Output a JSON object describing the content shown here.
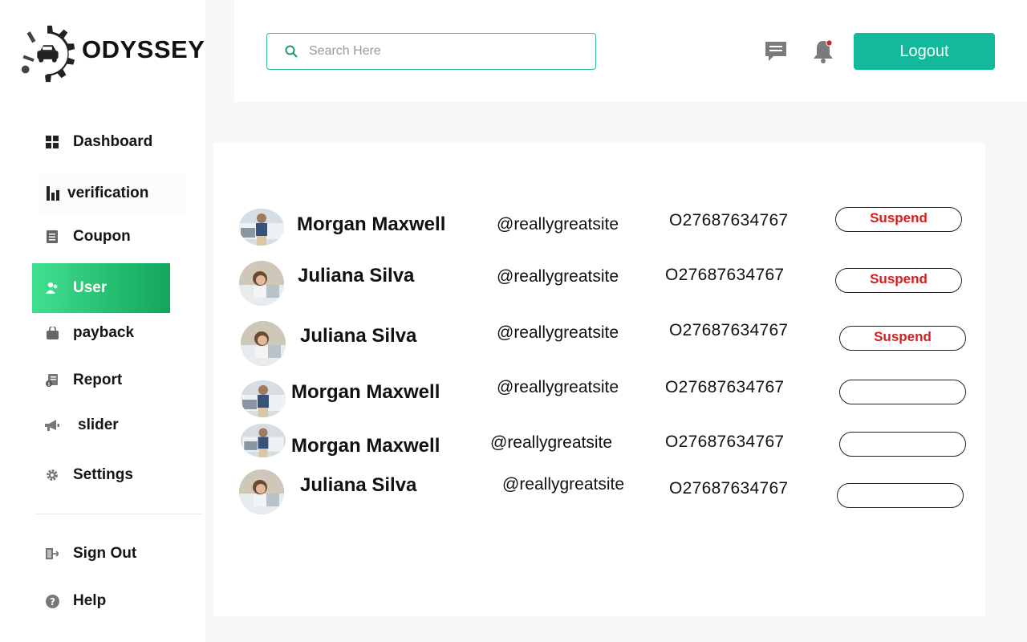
{
  "brand": {
    "name": "ODYSSEY"
  },
  "sidebar": {
    "items": [
      {
        "label": "Dashboard",
        "icon": "grid-icon"
      },
      {
        "label": "verification",
        "icon": "bar-chart-icon"
      },
      {
        "label": "Coupon",
        "icon": "document-icon"
      },
      {
        "label": "User",
        "icon": "user-icon",
        "active": true
      },
      {
        "label": "payback",
        "icon": "bag-icon"
      },
      {
        "label": "Report",
        "icon": "report-icon"
      },
      {
        "label": "slider",
        "icon": "megaphone-icon"
      },
      {
        "label": "Settings",
        "icon": "gear-icon"
      }
    ],
    "footer": [
      {
        "label": "Sign Out",
        "icon": "sign-out-icon"
      },
      {
        "label": "Help",
        "icon": "help-icon"
      }
    ]
  },
  "header": {
    "search_placeholder": "Search Here",
    "logout_label": "Logout"
  },
  "users": [
    {
      "name": "Morgan Maxwell",
      "handle": "@reallygreatsite",
      "phone": "O27687634767",
      "action": "Suspend",
      "avatar": "man-avatar"
    },
    {
      "name": "Juliana Silva",
      "handle": "@reallygreatsite",
      "phone": "O27687634767",
      "action": "Suspend",
      "avatar": "woman-avatar"
    },
    {
      "name": "Juliana Silva",
      "handle": "@reallygreatsite",
      "phone": "O27687634767",
      "action": "Suspend",
      "avatar": "woman-avatar"
    },
    {
      "name": "Morgan Maxwell",
      "handle": "@reallygreatsite",
      "phone": "O27687634767",
      "action": "",
      "avatar": "man-avatar"
    },
    {
      "name": "Morgan Maxwell",
      "handle": "@reallygreatsite",
      "phone": "O27687634767",
      "action": "",
      "avatar": "man-avatar"
    },
    {
      "name": "Juliana Silva",
      "handle": "@reallygreatsite",
      "phone": "O27687634767",
      "action": "",
      "avatar": "woman-avatar"
    }
  ],
  "colors": {
    "accent": "#14b89a",
    "active_nav_start": "#40e08f",
    "active_nav_end": "#12a55b",
    "suspend_text": "#d62020",
    "notification_dot": "#e02020"
  }
}
